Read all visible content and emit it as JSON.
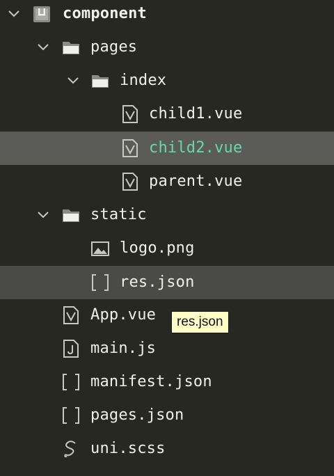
{
  "colors": {
    "background": "#272822",
    "selected_row": "#5b5c58",
    "hover_row": "#4a4b47",
    "text": "#f0f0ea",
    "active_text": "#66d9a6",
    "icon": "#c8c8c2",
    "tooltip_bg": "#fdfdc6"
  },
  "tree": {
    "root": {
      "label": "component",
      "icon": "project-icon",
      "expanded": true
    },
    "pages": {
      "label": "pages",
      "icon": "folder-icon",
      "expanded": true
    },
    "index": {
      "label": "index",
      "icon": "folder-icon",
      "expanded": true
    },
    "child1": {
      "label": "child1.vue",
      "icon": "vue-file-icon"
    },
    "child2": {
      "label": "child2.vue",
      "icon": "vue-file-icon",
      "selected": true
    },
    "parent": {
      "label": "parent.vue",
      "icon": "vue-file-icon"
    },
    "static": {
      "label": "static",
      "icon": "folder-icon",
      "expanded": true
    },
    "logo": {
      "label": "logo.png",
      "icon": "image-file-icon"
    },
    "res": {
      "label": "res.json",
      "icon": "json-file-icon",
      "hovered": true
    },
    "app": {
      "label": "App.vue",
      "icon": "vue-file-icon"
    },
    "main": {
      "label": "main.js",
      "icon": "js-file-icon"
    },
    "manifest": {
      "label": "manifest.json",
      "icon": "json-file-icon"
    },
    "pagesjson": {
      "label": "pages.json",
      "icon": "json-file-icon"
    },
    "uniscss": {
      "label": "uni.scss",
      "icon": "scss-file-icon"
    }
  },
  "tooltip": {
    "text": "res.json"
  }
}
